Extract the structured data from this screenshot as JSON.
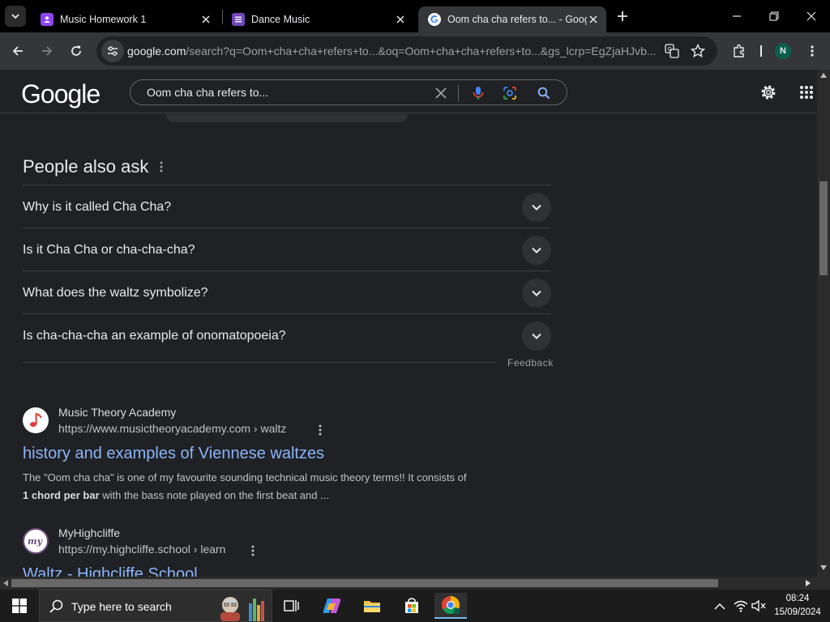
{
  "browser": {
    "tabs": [
      {
        "title": "Music Homework 1",
        "icon": "google-classroom-icon",
        "color": "#8e44ef",
        "active": false
      },
      {
        "title": "Dance Music",
        "icon": "google-forms-icon",
        "color": "#7248b9",
        "active": false
      },
      {
        "title": "Oom cha cha refers to... - Google",
        "icon": "google-g-icon",
        "active": true
      }
    ],
    "url_host": "google.com",
    "url_path": "/search?q=Oom+cha+cha+refers+to...&oq=Oom+cha+cha+refers+to...&gs_lcrp=EgZjaHJvb...",
    "profile_initial": "N"
  },
  "google": {
    "logo": "Google",
    "search_query": "Oom cha cha refers to..."
  },
  "people_also_ask": {
    "title": "People also ask",
    "questions": [
      "Why is it called Cha Cha?",
      "Is it Cha Cha or cha-cha-cha?",
      "What does the waltz symbolize?",
      "Is cha-cha-cha an example of onomatopoeia?"
    ],
    "feedback": "Feedback"
  },
  "results": [
    {
      "site": "Music Theory Academy",
      "url": "https://www.musictheoryacademy.com › waltz",
      "title": "history and examples of Viennese waltzes",
      "snippet_line1": "The \"Oom cha cha\" is one of my favourite sounding technical music theory terms!! It consists of",
      "snippet_bold": "1 chord per bar",
      "snippet_line2_rest": " with the bass note played on the first beat and ..."
    },
    {
      "site": "MyHighcliffe",
      "url": "https://my.highcliffe.school › learn",
      "title": "Waltz - Highcliffe School"
    }
  ],
  "taskbar": {
    "search_placeholder": "Type here to search",
    "time": "08:24",
    "date": "15/09/2024"
  },
  "colors": {
    "link_blue": "#8ab4f8",
    "page_bg": "#202124",
    "accent_task": "#76b9ed"
  }
}
